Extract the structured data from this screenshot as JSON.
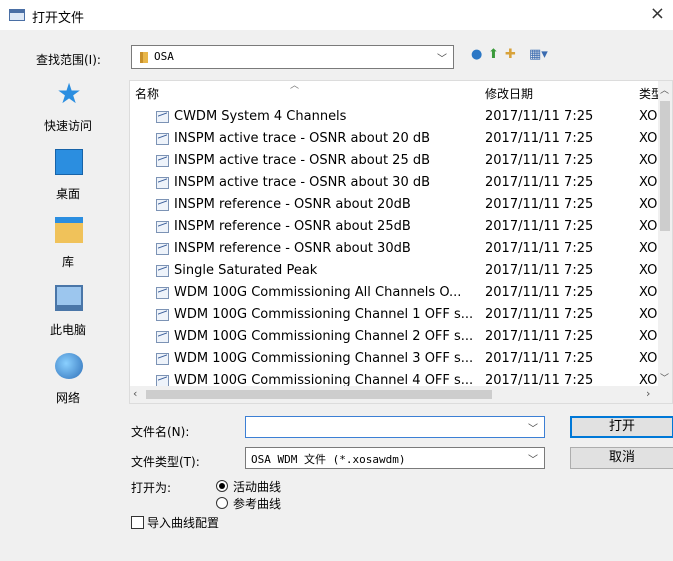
{
  "window": {
    "title": "打开文件",
    "close_glyph": "×"
  },
  "lookin": {
    "label": "查找范围(I):",
    "value": "OSA"
  },
  "toolbar": {
    "back_icon": "back-icon",
    "up_icon": "up-folder-icon",
    "new_folder_icon": "new-folder-icon",
    "view_icon": "view-menu-icon"
  },
  "places": [
    {
      "label": "快速访问",
      "icon": "quick-access-icon"
    },
    {
      "label": "桌面",
      "icon": "desktop-icon"
    },
    {
      "label": "库",
      "icon": "libraries-icon"
    },
    {
      "label": "此电脑",
      "icon": "this-pc-icon"
    },
    {
      "label": "网络",
      "icon": "network-icon"
    }
  ],
  "filelist": {
    "columns": {
      "name": "名称",
      "date": "修改日期",
      "type": "类型"
    },
    "rows": [
      {
        "name": "CWDM System 4 Channels",
        "date": "2017/11/11 7:25",
        "type": "XO"
      },
      {
        "name": "INSPM active trace - OSNR about 20 dB",
        "date": "2017/11/11 7:25",
        "type": "XO"
      },
      {
        "name": "INSPM active trace - OSNR about 25 dB",
        "date": "2017/11/11 7:25",
        "type": "XO"
      },
      {
        "name": "INSPM active trace - OSNR about 30 dB",
        "date": "2017/11/11 7:25",
        "type": "XO"
      },
      {
        "name": "INSPM reference - OSNR about 20dB",
        "date": "2017/11/11 7:25",
        "type": "XO"
      },
      {
        "name": "INSPM reference - OSNR about 25dB",
        "date": "2017/11/11 7:25",
        "type": "XO"
      },
      {
        "name": "INSPM reference - OSNR about 30dB",
        "date": "2017/11/11 7:25",
        "type": "XO"
      },
      {
        "name": "Single Saturated Peak",
        "date": "2017/11/11 7:25",
        "type": "XO"
      },
      {
        "name": "WDM 100G Commissioning All Channels O...",
        "date": "2017/11/11 7:25",
        "type": "XO"
      },
      {
        "name": "WDM 100G Commissioning Channel 1 OFF s...",
        "date": "2017/11/11 7:25",
        "type": "XO"
      },
      {
        "name": "WDM 100G Commissioning Channel 2 OFF s...",
        "date": "2017/11/11 7:25",
        "type": "XO"
      },
      {
        "name": "WDM 100G Commissioning Channel 3 OFF s...",
        "date": "2017/11/11 7:25",
        "type": "XO"
      },
      {
        "name": "WDM 100G Commissioning Channel 4 OFF s...",
        "date": "2017/11/11 7:25",
        "type": "XO"
      }
    ]
  },
  "filename": {
    "label": "文件名(N):",
    "value": ""
  },
  "filetype": {
    "label": "文件类型(T):",
    "value": "OSA WDM 文件 (*.xosawdm)"
  },
  "buttons": {
    "open": "打开",
    "cancel": "取消"
  },
  "open_as": {
    "label": "打开为:",
    "options": [
      {
        "label": "活动曲线",
        "selected": true
      },
      {
        "label": "参考曲线",
        "selected": false
      }
    ]
  },
  "import_config": {
    "label": "导入曲线配置",
    "checked": false
  }
}
